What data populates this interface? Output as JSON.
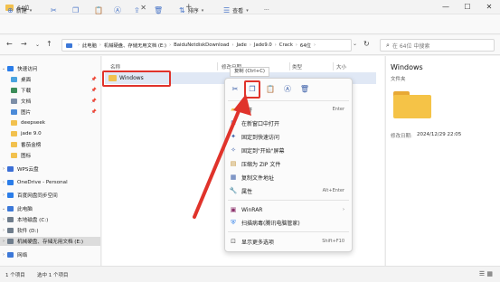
{
  "window": {
    "tab_title": "64位",
    "tab_close": "✕",
    "new_tab": "+",
    "min": "—",
    "max": "☐",
    "close": "✕"
  },
  "toolbar": {
    "new_label": "新建",
    "sort_label": "排序",
    "view_label": "查看",
    "more": "···"
  },
  "address": {
    "segments": [
      "此电脑",
      "机械硬盘、存储无用文档 (E:)",
      "BaiduNetdiskDownload",
      "Jade",
      "Jade9.0",
      "Crack",
      "64位"
    ],
    "search_placeholder": "在 64位 中搜索"
  },
  "sidebar": {
    "items": [
      {
        "label": "快速访问",
        "color": "#2b7de9"
      },
      {
        "label": "桌面",
        "color": "#4aa3df"
      },
      {
        "label": "下载",
        "color": "#3c8d5a"
      },
      {
        "label": "文档",
        "color": "#7d8fa8"
      },
      {
        "label": "图片",
        "color": "#4a8ad8"
      },
      {
        "label": "deepseek",
        "color": "#f2c14e"
      },
      {
        "label": "jade 9.0",
        "color": "#f2c14e"
      },
      {
        "label": "番茄金榜",
        "color": "#f2c14e"
      },
      {
        "label": "图标",
        "color": "#f2c14e"
      },
      {
        "label": "WPS云盘",
        "color": "#3c6fd6"
      },
      {
        "label": "OneDrive - Personal",
        "color": "#2b7de9"
      },
      {
        "label": "百度网盘同步空间",
        "color": "#2b7de9"
      },
      {
        "label": "此电脑",
        "color": "#3c78d8"
      },
      {
        "label": "本地磁盘 (C:)",
        "color": "#6f7d8c"
      },
      {
        "label": "软件 (D:)",
        "color": "#6f7d8c"
      },
      {
        "label": "机械硬盘、存储无用文档 (E:)",
        "color": "#6f7d8c"
      },
      {
        "label": "网络",
        "color": "#3c78d8"
      }
    ]
  },
  "list": {
    "col_name": "名称",
    "col_date": "修改日期",
    "col_type": "类型",
    "col_size": "大小",
    "file_name": "Windows"
  },
  "preview": {
    "title": "Windows",
    "type": "文件夹",
    "date_label": "修改日期:",
    "date": "2024/12/29 22:05"
  },
  "status": {
    "count": "1 个项目",
    "selected": "选中 1 个项目"
  },
  "context_menu": {
    "tooltip": "复制 (Ctrl+C)",
    "items": [
      {
        "label": "打开",
        "shortcut": "Enter"
      },
      {
        "label": "在新窗口中打开",
        "shortcut": ""
      },
      {
        "label": "固定到快速访问",
        "shortcut": ""
      },
      {
        "label": "固定到\"开始\"屏幕",
        "shortcut": ""
      },
      {
        "label": "压缩为 ZIP 文件",
        "shortcut": ""
      },
      {
        "label": "复制文件地址",
        "shortcut": ""
      },
      {
        "label": "属性",
        "shortcut": "Alt+Enter"
      },
      {
        "label": "WinRAR",
        "shortcut": "›"
      },
      {
        "label": "扫描病毒(腾讯电脑管家)",
        "shortcut": ""
      },
      {
        "label": "显示更多选项",
        "shortcut": "Shift+F10"
      }
    ]
  },
  "colors": {
    "highlight": "#e0332b",
    "folder": "#f2c14e"
  }
}
